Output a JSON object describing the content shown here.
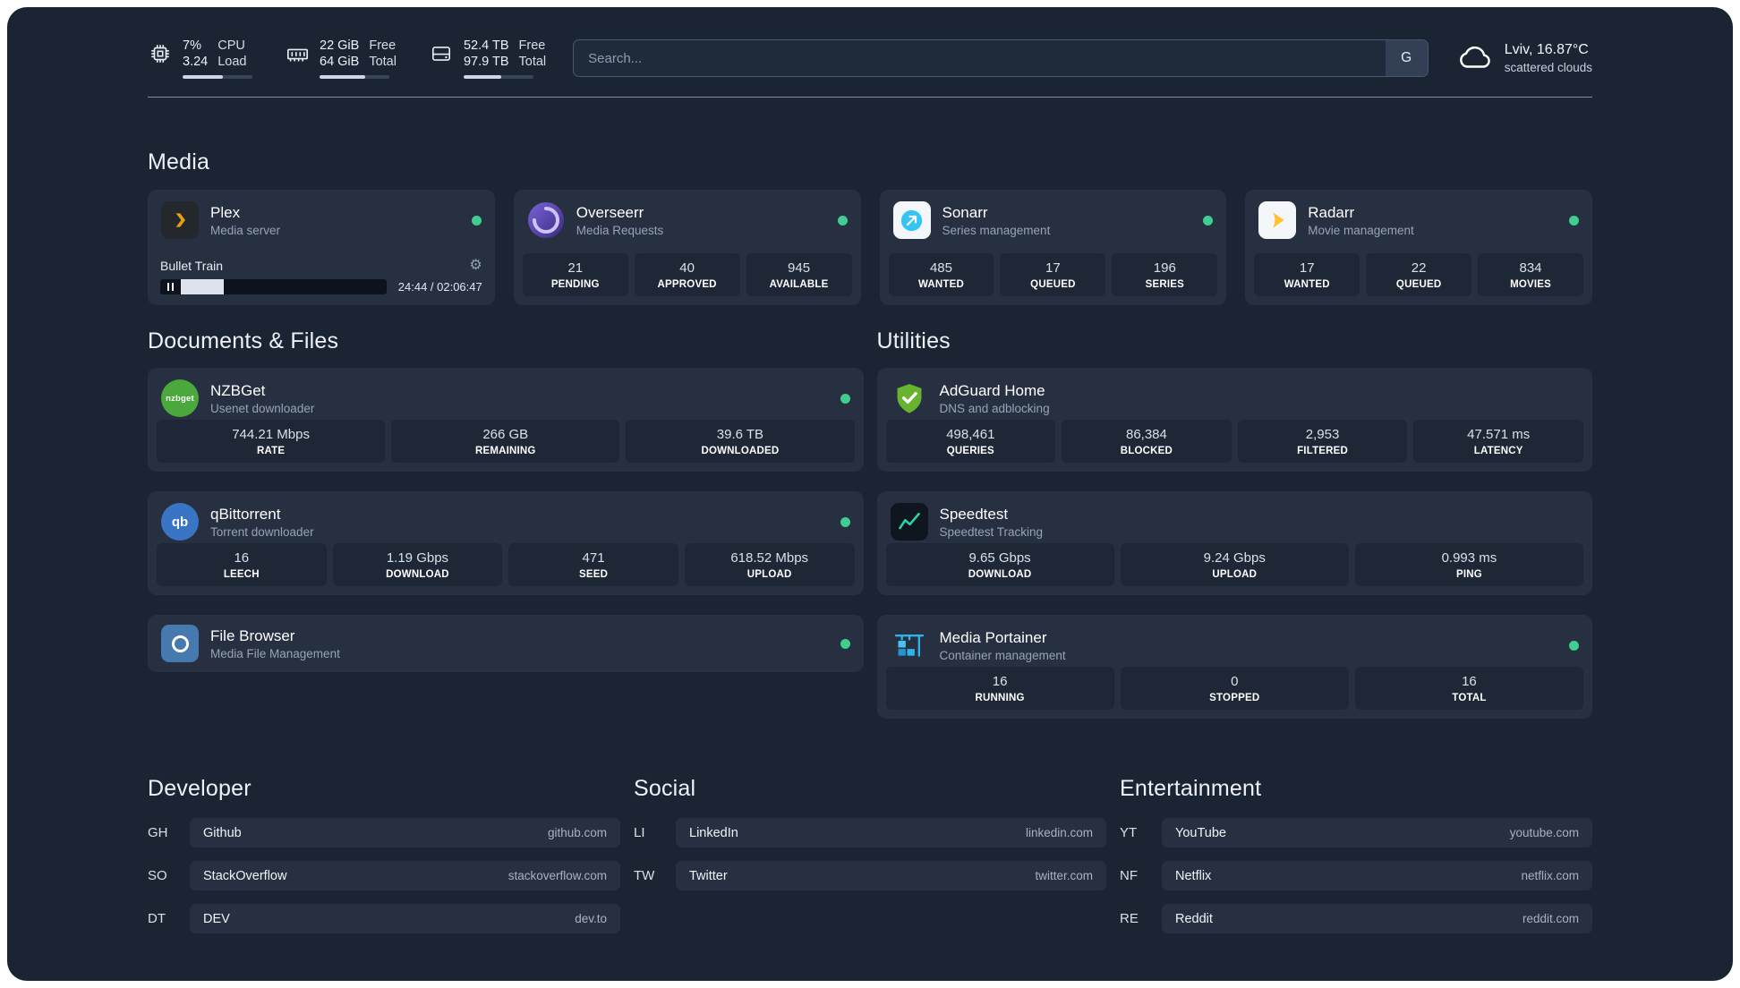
{
  "topbar": {
    "cpu": {
      "percent": "7%",
      "load": "3.24",
      "label_top": "CPU",
      "label_bottom": "Load",
      "bar_percent": 58
    },
    "memory": {
      "free": "22 GiB",
      "total": "64 GiB",
      "label_top": "Free",
      "label_bottom": "Total",
      "bar_percent": 66
    },
    "disk": {
      "free": "52.4 TB",
      "total": "97.9 TB",
      "label_top": "Free",
      "label_bottom": "Total",
      "bar_percent": 54
    },
    "search": {
      "placeholder": "Search...",
      "provider": "G"
    },
    "weather": {
      "location": "Lviv, 16.87°C",
      "condition": "scattered clouds"
    }
  },
  "icons": {
    "gear_glyph": "⚙"
  },
  "colors": {
    "status_ok": "#3fce8f",
    "plex_accent": "#e5a00d",
    "panel_bg": "#1b2433",
    "card_bg": "#273040"
  },
  "sections": {
    "media": {
      "title": "Media",
      "plex": {
        "name": "Plex",
        "subtitle": "Media server",
        "now_playing": "Bullet Train",
        "time": "24:44 / 02:06:47",
        "progress_percent": 19
      },
      "overseerr": {
        "name": "Overseerr",
        "subtitle": "Media Requests",
        "stats": [
          {
            "value": "21",
            "label": "PENDING"
          },
          {
            "value": "40",
            "label": "APPROVED"
          },
          {
            "value": "945",
            "label": "AVAILABLE"
          }
        ]
      },
      "sonarr": {
        "name": "Sonarr",
        "subtitle": "Series management",
        "stats": [
          {
            "value": "485",
            "label": "WANTED"
          },
          {
            "value": "17",
            "label": "QUEUED"
          },
          {
            "value": "196",
            "label": "SERIES"
          }
        ]
      },
      "radarr": {
        "name": "Radarr",
        "subtitle": "Movie management",
        "stats": [
          {
            "value": "17",
            "label": "WANTED"
          },
          {
            "value": "22",
            "label": "QUEUED"
          },
          {
            "value": "834",
            "label": "MOVIES"
          }
        ]
      }
    },
    "documents": {
      "title": "Documents & Files",
      "nzbget": {
        "name": "NZBGet",
        "subtitle": "Usenet downloader",
        "icon_label": "nzbget",
        "stats": [
          {
            "value": "744.21 Mbps",
            "label": "RATE"
          },
          {
            "value": "266 GB",
            "label": "REMAINING"
          },
          {
            "value": "39.6 TB",
            "label": "DOWNLOADED"
          }
        ]
      },
      "qbittorrent": {
        "name": "qBittorrent",
        "subtitle": "Torrent downloader",
        "icon_label": "qb",
        "stats": [
          {
            "value": "16",
            "label": "LEECH"
          },
          {
            "value": "1.19 Gbps",
            "label": "DOWNLOAD"
          },
          {
            "value": "471",
            "label": "SEED"
          },
          {
            "value": "618.52 Mbps",
            "label": "UPLOAD"
          }
        ]
      },
      "filebrowser": {
        "name": "File Browser",
        "subtitle": "Media File Management"
      }
    },
    "utilities": {
      "title": "Utilities",
      "adguard": {
        "name": "AdGuard Home",
        "subtitle": "DNS and adblocking",
        "stats": [
          {
            "value": "498,461",
            "label": "QUERIES"
          },
          {
            "value": "86,384",
            "label": "BLOCKED"
          },
          {
            "value": "2,953",
            "label": "FILTERED"
          },
          {
            "value": "47.571 ms",
            "label": "LATENCY"
          }
        ]
      },
      "speedtest": {
        "name": "Speedtest",
        "subtitle": "Speedtest Tracking",
        "stats": [
          {
            "value": "9.65 Gbps",
            "label": "DOWNLOAD"
          },
          {
            "value": "9.24 Gbps",
            "label": "UPLOAD"
          },
          {
            "value": "0.993 ms",
            "label": "PING"
          }
        ]
      },
      "portainer": {
        "name": "Media Portainer",
        "subtitle": "Container management",
        "stats": [
          {
            "value": "16",
            "label": "RUNNING"
          },
          {
            "value": "0",
            "label": "STOPPED"
          },
          {
            "value": "16",
            "label": "TOTAL"
          }
        ]
      }
    }
  },
  "bookmarks": {
    "developer": {
      "title": "Developer",
      "links": [
        {
          "abbr": "GH",
          "name": "Github",
          "url": "github.com"
        },
        {
          "abbr": "SO",
          "name": "StackOverflow",
          "url": "stackoverflow.com"
        },
        {
          "abbr": "DT",
          "name": "DEV",
          "url": "dev.to"
        }
      ]
    },
    "social": {
      "title": "Social",
      "links": [
        {
          "abbr": "LI",
          "name": "LinkedIn",
          "url": "linkedin.com"
        },
        {
          "abbr": "TW",
          "name": "Twitter",
          "url": "twitter.com"
        }
      ]
    },
    "entertainment": {
      "title": "Entertainment",
      "links": [
        {
          "abbr": "YT",
          "name": "YouTube",
          "url": "youtube.com"
        },
        {
          "abbr": "NF",
          "name": "Netflix",
          "url": "netflix.com"
        },
        {
          "abbr": "RE",
          "name": "Reddit",
          "url": "reddit.com"
        }
      ]
    }
  }
}
